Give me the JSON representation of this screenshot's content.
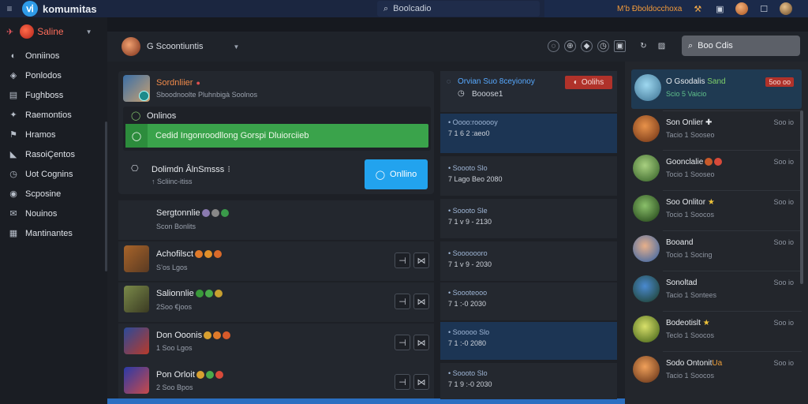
{
  "topbar": {
    "brand": "komumitas",
    "logo_glyph": "ⅵ",
    "search_placeholder": "Boolcadio",
    "notification_text": "M’b Ðboldocchoxa",
    "icons": [
      "hamburger-icon",
      "search-icon",
      "hammer-icon",
      "gallery-icon",
      "avatar",
      "window-icon",
      "avatar"
    ]
  },
  "sidebar": {
    "user_name": "Saline",
    "items": [
      {
        "label": "Onniinos",
        "icon": "chat-icon"
      },
      {
        "label": "Ponlodos",
        "icon": "tag-icon"
      },
      {
        "label": "Fughboss",
        "icon": "book-icon"
      },
      {
        "label": "Raemontios",
        "icon": "puzzle-icon"
      },
      {
        "label": "Hramos",
        "icon": "flag-icon"
      },
      {
        "label": "RasoiÇentos",
        "icon": "megaphone-icon"
      },
      {
        "label": "Uot Cognins",
        "icon": "clock-icon"
      },
      {
        "label": "Scposine",
        "icon": "controller-icon"
      },
      {
        "label": "Nouinos",
        "icon": "mail-icon"
      },
      {
        "label": "Mantinantes",
        "icon": "grid-icon"
      }
    ]
  },
  "subheader": {
    "user_label": "G Scoontiuntis",
    "search_placeholder": "Boo Cdis"
  },
  "feed": {
    "card": {
      "title": "Sordnliier",
      "subtitle": "Sboodnoolte Pluhnbigà Soolnos",
      "inner_label": "Onlinos",
      "progress_text": "Cedid Ingonroodllong Gorspi Dluiorciieb",
      "member_title": "Dolimdn ÂlnSmsss",
      "member_sub": "↑ Scliinc-itiss",
      "online_button": "Onllino"
    },
    "rows": [
      {
        "title": "Sergtonnlie",
        "sub": "Scon Bonlits",
        "action": false
      },
      {
        "title": "Achofilsct",
        "sub": "S’os Lgos",
        "action": true
      },
      {
        "title": "Salionnlie",
        "sub": "2Soo €joos",
        "action": true
      },
      {
        "title": "Don Ooonis",
        "sub": "1 Soo Lgos",
        "action": true
      },
      {
        "title": "Pon Orloit",
        "sub": "2 Soo Bpos",
        "action": true
      }
    ]
  },
  "mid": {
    "header_title": "Orvian Suo 8ceyionoy",
    "header_value": "Booose1",
    "alert_button": "Oolihs",
    "items": [
      {
        "line1": "• Oooo:roooooy",
        "line2": "7 1 6 2 :aeo0"
      },
      {
        "line1": "• Soooto Slo",
        "line2": "7 Lago Beo 2080"
      },
      {
        "line1": "• Soooto Sle",
        "line2": "7 1 v 9 - 2130"
      },
      {
        "line1": "• Sooooooro",
        "line2": "7 1 v 9 - 2030"
      },
      {
        "line1": "• Soooteooo",
        "line2": "7 1 :-0 2030"
      },
      {
        "line1": "• Sooooo Slo",
        "line2": "7 1 :-0 2080"
      },
      {
        "line1": "• Soooto Slo",
        "line2": "7 1 9 :-0 2030"
      }
    ]
  },
  "right": {
    "items": [
      {
        "name": "O Gsodalis",
        "tag": "Sand",
        "stat": "Scio 5 Vaicio",
        "time": "5oo oo",
        "color": "#6fb8e0"
      },
      {
        "name": "Son Onlier",
        "tag": "✚",
        "stat": "Tacio 1 Sooseo",
        "time": "Soo io",
        "color": "#c76a2a"
      },
      {
        "name": "Goonclalie",
        "tag": "",
        "stat": "Tocio 1 Sooseo",
        "time": "Soo io",
        "color": "#5fa35a"
      },
      {
        "name": "Soo Onlitor",
        "tag": "★",
        "stat": "Tocio 1 Soocos",
        "time": "Soo io",
        "color": "#4aa84a"
      },
      {
        "name": "Booand",
        "tag": "",
        "stat": "Tocio 1 Socing",
        "time": "Soo io",
        "color": "#4a92d6"
      },
      {
        "name": "Sonoltad",
        "tag": "",
        "stat": "Tacio 1 Sontees",
        "time": "Soo io",
        "color": "#3b8a3b"
      },
      {
        "name": "Bodeotislt",
        "tag": "★",
        "stat": "Teclo 1 Soocos",
        "time": "Soo io",
        "color": "#b4c23d"
      },
      {
        "name": "Sodo Ontonit",
        "tag": "Ua",
        "stat": "Tacio 1 Soocos",
        "time": "Soo io",
        "color": "#c56a26"
      }
    ]
  },
  "colors": {
    "accent_blue": "#22a3ee",
    "accent_green": "#3aa34b",
    "accent_red": "#b0322a",
    "brand_red": "#ff6d5a"
  }
}
